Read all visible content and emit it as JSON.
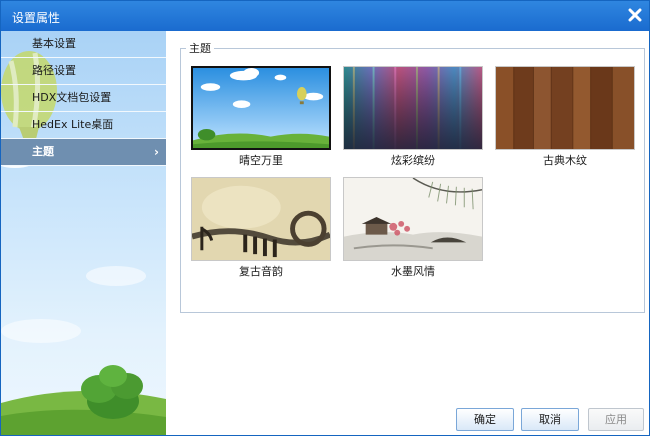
{
  "window": {
    "title": "设置属性",
    "close_icon": "close-icon"
  },
  "sidebar": {
    "items": [
      {
        "label": "基本设置",
        "active": false
      },
      {
        "label": "路径设置",
        "active": false
      },
      {
        "label": "HDX文档包设置",
        "active": false
      },
      {
        "label": "HedEx Lite桌面",
        "active": false
      },
      {
        "label": "主题",
        "active": true,
        "icon": "chevron-right-icon"
      }
    ]
  },
  "themes": {
    "legend": "主题",
    "items": [
      {
        "label": "晴空万里",
        "selected": true
      },
      {
        "label": "炫彩缤纷",
        "selected": false
      },
      {
        "label": "古典木纹",
        "selected": false
      },
      {
        "label": "复古音韵",
        "selected": false
      },
      {
        "label": "水墨风情",
        "selected": false
      }
    ]
  },
  "buttons": {
    "ok": "确定",
    "cancel": "取消",
    "apply": "应用"
  },
  "colors": {
    "titlebar": "#1a6bcf",
    "sidebar_active": "#6f8fb0",
    "button_border": "#7aa7d8"
  }
}
